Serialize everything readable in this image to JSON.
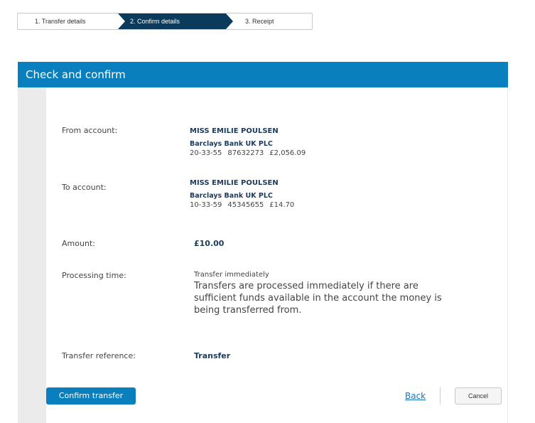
{
  "stepper": {
    "steps": [
      {
        "label": "1. Transfer details"
      },
      {
        "label": "2. Confirm details"
      },
      {
        "label": "3. Receipt"
      }
    ]
  },
  "panel": {
    "title": "Check and confirm"
  },
  "from": {
    "label": "From account:",
    "name": "MISS EMILIE POULSEN",
    "bank": "Barclays Bank UK PLC",
    "sort_code": "20-33-55",
    "account_number": "87632273",
    "balance": "£2,056.09"
  },
  "to": {
    "label": "To account:",
    "name": "MISS EMILIE POULSEN",
    "bank": "Barclays Bank UK PLC",
    "sort_code": "10-33-59",
    "account_number": "45345655",
    "balance": "£14.70"
  },
  "amount": {
    "label": "Amount:",
    "value": "£10.00"
  },
  "processing": {
    "label": "Processing time:",
    "value": "Transfer immediately",
    "description": "Transfers are processed immediately if there are sufficient funds available in the account the money is being transferred from."
  },
  "reference": {
    "label": "Transfer reference:",
    "value": "Transfer"
  },
  "actions": {
    "confirm": "Confirm transfer",
    "back": "Back",
    "cancel": "Cancel"
  },
  "colors": {
    "header_blue": "#0a7fbd",
    "active_step_navy": "#0a3a5c",
    "link_blue": "#1a73b8"
  }
}
